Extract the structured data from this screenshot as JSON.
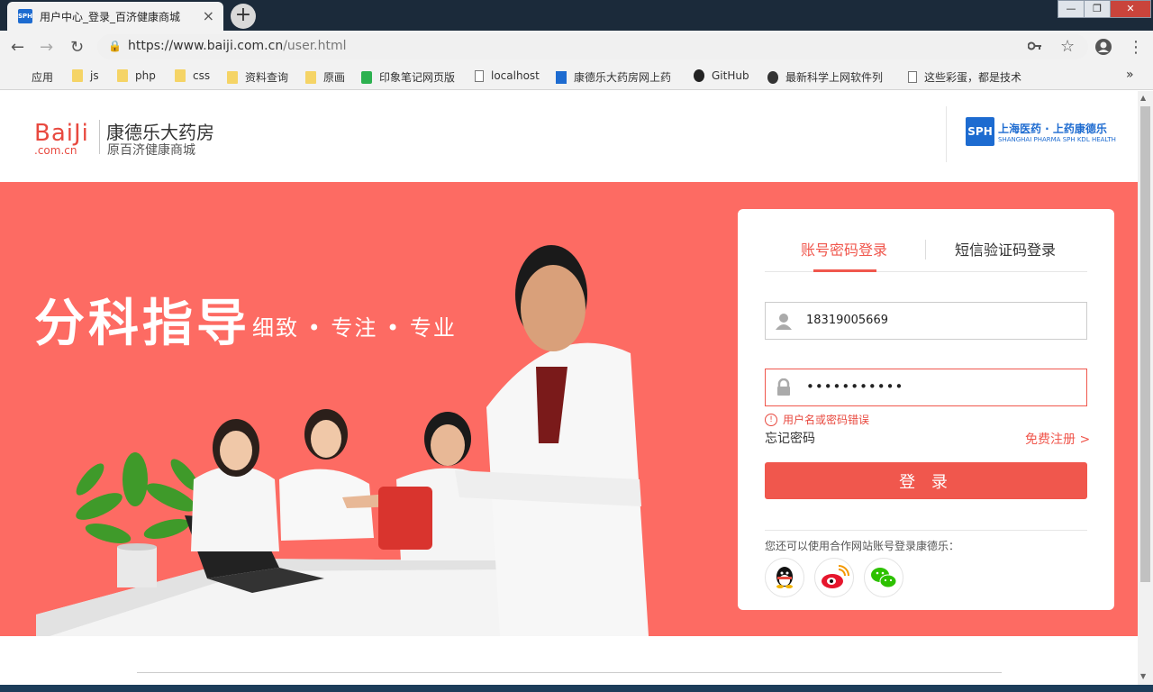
{
  "browser": {
    "tab_title": "用户中心_登录_百济健康商城",
    "tab_favicon": "SPH",
    "tab_close": "×",
    "new_tab": "+",
    "url_host": "https://www.baiji.com.cn",
    "url_path": "/user.html",
    "window_buttons": {
      "minimize": "—",
      "maximize": "❐",
      "close": "✕"
    },
    "nav": {
      "back": "←",
      "forward": "→",
      "reload": "↻",
      "more": "⋮",
      "expand": "»"
    },
    "bookmarks": [
      {
        "label": "应用",
        "icon": "apps-icon"
      },
      {
        "label": "js",
        "icon": "folder-icon"
      },
      {
        "label": "php",
        "icon": "folder-icon"
      },
      {
        "label": "css",
        "icon": "folder-icon"
      },
      {
        "label": "资料查询",
        "icon": "folder-icon"
      },
      {
        "label": "原画",
        "icon": "folder-icon"
      },
      {
        "label": "印象笔记网页版",
        "icon": "evernote-icon"
      },
      {
        "label": "localhost",
        "icon": "page-icon"
      },
      {
        "label": "康德乐大药房网上药",
        "icon": "sph-icon"
      },
      {
        "label": "GitHub",
        "icon": "github-icon"
      },
      {
        "label": "最新科学上网软件列",
        "icon": "kx-icon"
      },
      {
        "label": "这些彩蛋，都是技术",
        "icon": "page-icon"
      }
    ]
  },
  "header": {
    "logo_text": "BaiJi",
    "logo_domain": ".com.cn",
    "brand_name": "康德乐大药房",
    "brand_sub": "原百济健康商城",
    "partner_logo_box": "SPH",
    "partner_logo_cn": "上海医药 · 上药康德乐",
    "partner_logo_en": "SHANGHAI PHARMA   SPH KDL HEALTH"
  },
  "hero": {
    "title": "分科指导",
    "subtitle": "细致 • 专注 • 专业"
  },
  "login": {
    "tabs": {
      "account": "账号密码登录",
      "sms": "短信验证码登录"
    },
    "username": "18319005669",
    "password_mask": "•••••••••••",
    "error": "用户名或密码错误",
    "error_icon": "!",
    "forgot": "忘记密码",
    "register": "免费注册 >",
    "submit": "登 录",
    "social_text": "您还可以使用合作网站账号登录康德乐：",
    "social": [
      "qq-icon",
      "weibo-icon",
      "wechat-icon"
    ]
  },
  "colors": {
    "accent": "#f0574d",
    "hero_bg": "#fd6b63",
    "brand_blue": "#1d6bd0"
  }
}
